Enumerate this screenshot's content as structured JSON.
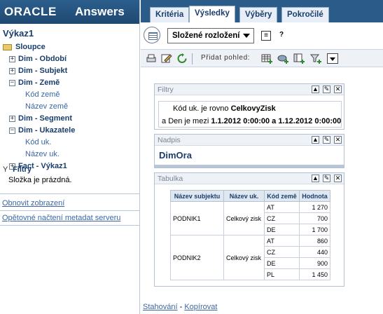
{
  "brand": {
    "logo_text": "ORACLE",
    "product": "Answers"
  },
  "sidebar": {
    "title": "Výkaz1",
    "root_label": "Sloupce",
    "folders": [
      {
        "label": "Dim - Období",
        "expanded": false,
        "items": []
      },
      {
        "label": "Dim - Subjekt",
        "expanded": false,
        "items": []
      },
      {
        "label": "Dim - Země",
        "expanded": true,
        "items": [
          "Kód země",
          "Název země"
        ]
      },
      {
        "label": "Dim - Segment",
        "expanded": false,
        "items": []
      },
      {
        "label": "Dim - Ukazatele",
        "expanded": true,
        "items": [
          "Kód uk.",
          "Název uk."
        ]
      },
      {
        "label": "Fact - Výkaz1",
        "expanded": false,
        "items": []
      }
    ],
    "filters_label": "Filtry",
    "filters_empty": "Složka je prázdná.",
    "link_refresh": "Obnovit zobrazení",
    "link_reload": "Opětovné načtení metadat serveru"
  },
  "tabs": [
    {
      "label": "Kritéria",
      "active": false
    },
    {
      "label": "Výsledky",
      "active": true
    },
    {
      "label": "Výběry",
      "active": false
    },
    {
      "label": "Pokročilé",
      "active": false
    }
  ],
  "toolbar": {
    "layout_select": "Složené rozložení",
    "add_view_label": "Přidat pohled:"
  },
  "filters_panel": {
    "title": "Filtry",
    "line1_prefix": "Kód uk. je rovno ",
    "line1_value": "CelkovyZisk",
    "line2_a": "a ",
    "line2_mid": "Den je mezi ",
    "line2_from": "1.1.2012 0:00:00",
    "line2_and": " a ",
    "line2_to": "1.12.2012 0:00:00"
  },
  "title_panel": {
    "title": "Nadpis",
    "text": "DimOra"
  },
  "table_panel": {
    "title": "Tabulka",
    "columns": [
      "Název subjektu",
      "Název uk.",
      "Kód země",
      "Hodnota"
    ],
    "groups": [
      {
        "subject": "PODNIK1",
        "indicator": "Celkový zisk",
        "rows": [
          {
            "country": "AT",
            "value": "1 270"
          },
          {
            "country": "CZ",
            "value": "700"
          },
          {
            "country": "DE",
            "value": "1 700"
          }
        ]
      },
      {
        "subject": "PODNIK2",
        "indicator": "Celkový zisk",
        "rows": [
          {
            "country": "AT",
            "value": "860"
          },
          {
            "country": "CZ",
            "value": "440"
          },
          {
            "country": "DE",
            "value": "900"
          },
          {
            "country": "PL",
            "value": "1 450"
          }
        ]
      }
    ]
  },
  "bottom_links": {
    "download": "Stahování",
    "sep": " - ",
    "copy": "Kopírovat"
  }
}
